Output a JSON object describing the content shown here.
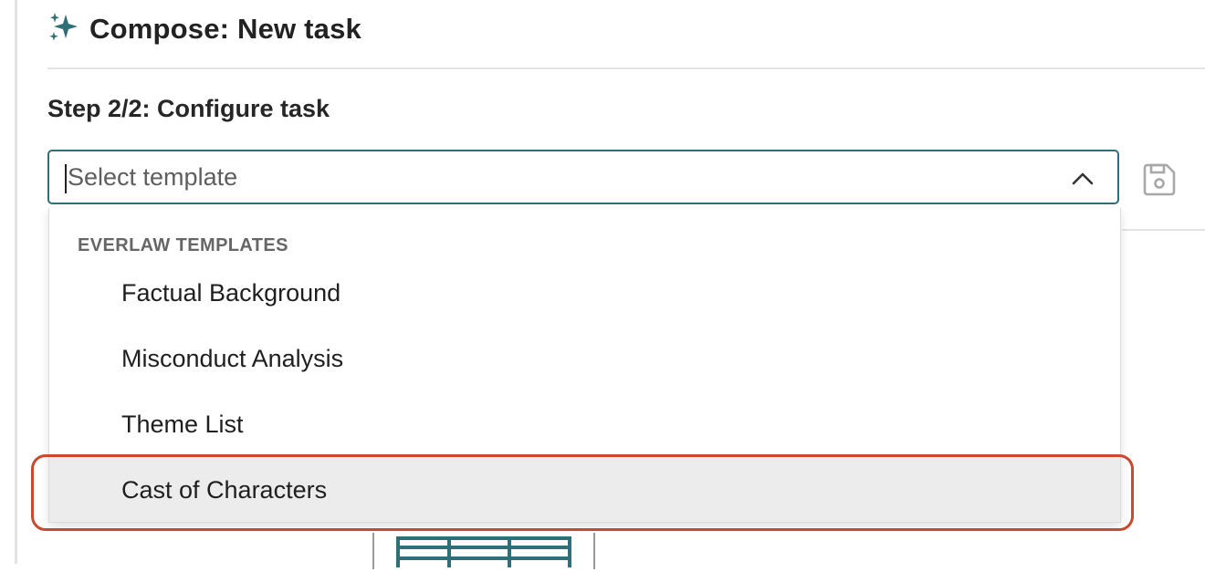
{
  "header": {
    "title": "Compose: New task",
    "icon": "sparkles-icon",
    "icon_color": "#2f6f78"
  },
  "step": {
    "label": "Step 2/2: Configure task"
  },
  "template_select": {
    "placeholder": "Select template",
    "value": "",
    "expanded": true,
    "border_color": "#2f6f78"
  },
  "save_button": {
    "icon": "save-icon"
  },
  "dropdown": {
    "group_label": "EVERLAW TEMPLATES",
    "options": [
      {
        "label": "Factual Background"
      },
      {
        "label": "Misconduct Analysis"
      },
      {
        "label": "Theme List"
      },
      {
        "label": "Cast of Characters",
        "hovered": true
      }
    ]
  },
  "highlight": {
    "target": "Cast of Characters",
    "color": "#c94a2e"
  },
  "preview": {
    "icon": "table-icon",
    "color": "#2f6f78"
  }
}
